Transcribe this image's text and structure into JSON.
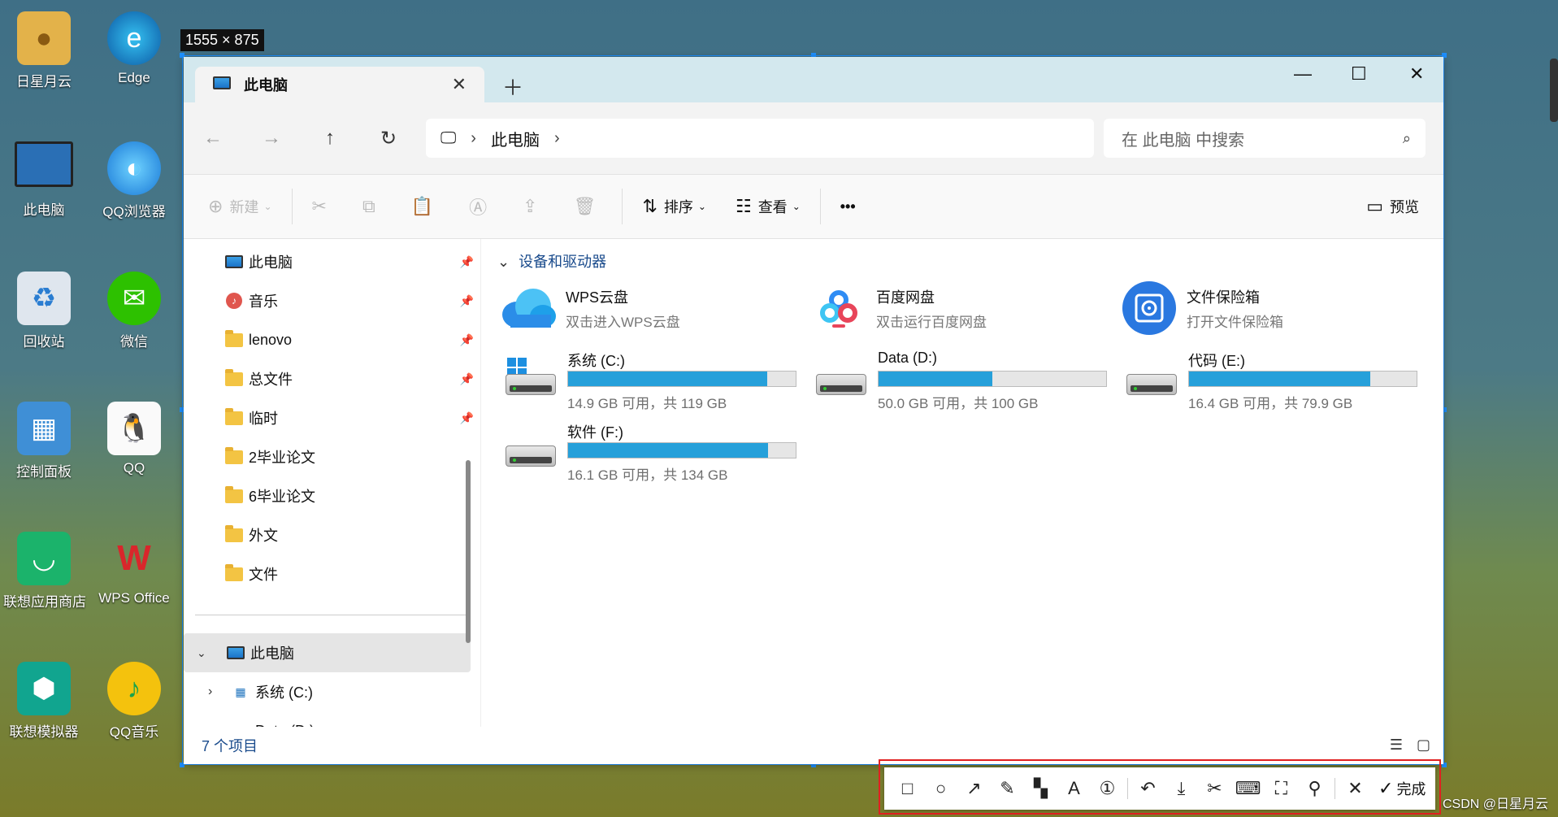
{
  "desktop": {
    "icons": [
      {
        "label": "日星月云",
        "icon": "user-folder-icon"
      },
      {
        "label": "Edge",
        "icon": "edge-icon"
      },
      {
        "label": "此电脑",
        "icon": "computer-icon"
      },
      {
        "label": "QQ浏览器",
        "icon": "qq-browser-icon"
      },
      {
        "label": "回收站",
        "icon": "recycle-bin-icon"
      },
      {
        "label": "微信",
        "icon": "wechat-icon"
      },
      {
        "label": "控制面板",
        "icon": "control-panel-icon"
      },
      {
        "label": "QQ",
        "icon": "qq-icon"
      },
      {
        "label": "联想应用商店",
        "icon": "lenovo-store-icon"
      },
      {
        "label": "WPS Office",
        "icon": "wps-icon"
      },
      {
        "label": "联想模拟器",
        "icon": "lenovo-emulator-icon"
      },
      {
        "label": "QQ音乐",
        "icon": "qq-music-icon"
      }
    ]
  },
  "selection": {
    "size_label": "1555 × 875"
  },
  "window": {
    "tab_title": "此电脑",
    "path": {
      "root": "此电脑"
    },
    "search_placeholder": "在 此电脑 中搜索",
    "toolbar": {
      "new": "新建",
      "sort": "排序",
      "view": "查看",
      "more": "•••",
      "preview": "预览"
    },
    "nav": {
      "quick": [
        {
          "label": "此电脑",
          "type": "computer",
          "pinned": true
        },
        {
          "label": "音乐",
          "type": "music",
          "pinned": true
        },
        {
          "label": "lenovo",
          "type": "folder",
          "pinned": true
        },
        {
          "label": "总文件",
          "type": "folder",
          "pinned": true
        },
        {
          "label": "临时",
          "type": "folder",
          "pinned": true
        },
        {
          "label": "2毕业论文",
          "type": "folder",
          "pinned": false
        },
        {
          "label": "6毕业论文",
          "type": "folder",
          "pinned": false
        },
        {
          "label": "外文",
          "type": "folder",
          "pinned": false
        },
        {
          "label": "文件",
          "type": "folder",
          "pinned": false
        }
      ],
      "tree_root": "此电脑",
      "tree_children": [
        "系统 (C:)",
        "Data (D:)"
      ]
    },
    "section_title": "设备和驱动器",
    "apps": [
      {
        "name": "WPS云盘",
        "desc": "双击进入WPS云盘"
      },
      {
        "name": "百度网盘",
        "desc": "双击运行百度网盘"
      },
      {
        "name": "文件保险箱",
        "desc": "打开文件保险箱"
      }
    ],
    "drives": [
      {
        "name": "系统 (C:)",
        "usage": "14.9 GB 可用，共 119 GB",
        "used_fraction": 0.875
      },
      {
        "name": "Data (D:)",
        "usage": "50.0 GB 可用，共 100 GB",
        "used_fraction": 0.5
      },
      {
        "name": "代码 (E:)",
        "usage": "16.4 GB 可用，共 79.9 GB",
        "used_fraction": 0.795
      },
      {
        "name": "软件 (F:)",
        "usage": "16.1 GB 可用，共 134 GB",
        "used_fraction": 0.88
      }
    ],
    "status_count": "7 个项目"
  },
  "screenshot_tools": {
    "done_label": "完成"
  },
  "watermark": "CSDN @日星月云",
  "colors": {
    "accent": "#26a0da",
    "title_bar": "#d3e8ee",
    "outline_red": "#e02020"
  }
}
